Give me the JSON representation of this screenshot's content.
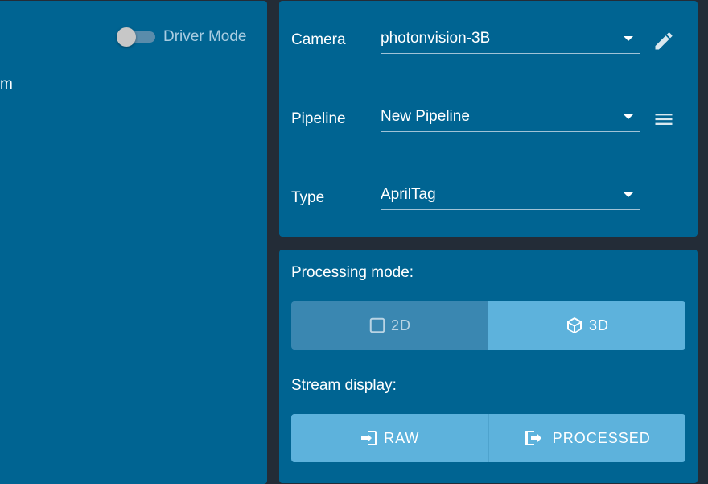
{
  "left_panel": {
    "driver_mode_label": "Driver Mode",
    "driver_mode_on": false,
    "cut_text": "m"
  },
  "selectors": {
    "camera": {
      "label": "Camera",
      "value": "photonvision-3B",
      "icon": "pencil-icon"
    },
    "pipeline": {
      "label": "Pipeline",
      "value": "New Pipeline",
      "icon": "menu-icon"
    },
    "type": {
      "label": "Type",
      "value": "AprilTag"
    }
  },
  "processing_mode": {
    "label": "Processing mode:",
    "options": [
      {
        "label": "2D",
        "icon": "square-icon",
        "selected": false
      },
      {
        "label": "3D",
        "icon": "cube-icon",
        "selected": true
      }
    ]
  },
  "stream_display": {
    "label": "Stream display:",
    "options": [
      {
        "label": "RAW",
        "icon": "login-icon"
      },
      {
        "label": "PROCESSED",
        "icon": "logout-icon"
      }
    ]
  },
  "colors": {
    "card_bg": "#006492",
    "page_bg": "#232c37",
    "accent_selected": "#5db2dc",
    "accent_unselected": "#3a87b1"
  }
}
